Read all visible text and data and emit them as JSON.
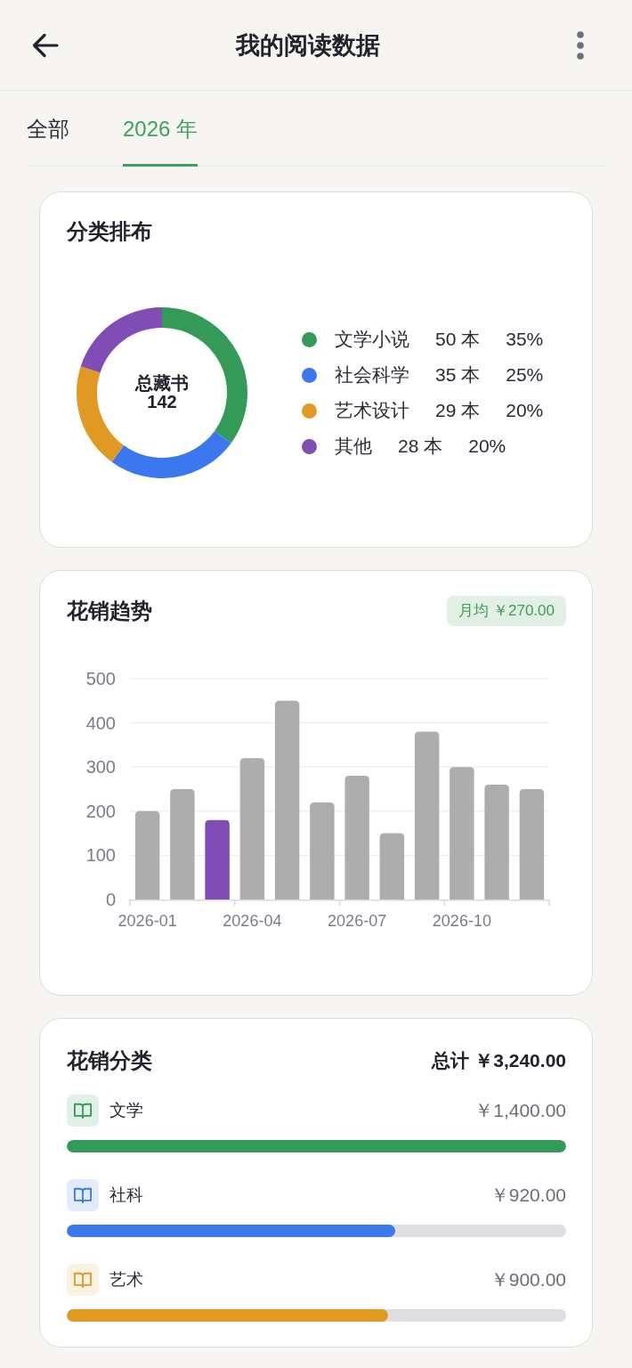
{
  "header": {
    "title": "我的阅读数据"
  },
  "tabs": [
    {
      "label": "全部",
      "selected": false
    },
    {
      "label": "2026 年",
      "selected": true
    }
  ],
  "category_card": {
    "title": "分类排布",
    "center": {
      "label": "总藏书",
      "value": "142"
    },
    "chart_data": {
      "type": "donut",
      "categories": [
        "文学小说",
        "社会科学",
        "艺术设计",
        "其他"
      ],
      "values": [
        35,
        25,
        20,
        20
      ]
    },
    "legend": [
      {
        "count": "50 本",
        "percent": "35%",
        "color": "#349a58"
      },
      {
        "count": "35 本",
        "percent": "25%",
        "color": "#3b78f0"
      },
      {
        "count": "29 本",
        "percent": "20%",
        "color": "#e09a24"
      },
      {
        "count": "28 本",
        "percent": "20%",
        "color": "#7f4db3"
      }
    ]
  },
  "trend_card": {
    "title": "花销趋势",
    "badge": "月均 ￥270.00",
    "chart_data": {
      "type": "bar",
      "categories": [
        "2026-01",
        null,
        null,
        "2026-04",
        null,
        null,
        "2026-07",
        null,
        null,
        "2026-10",
        null,
        null
      ],
      "series": [
        {
          "color": "#adadad",
          "values": [
            200,
            250,
            null,
            320,
            450,
            220,
            280,
            150,
            380,
            300,
            260,
            250
          ]
        },
        {
          "color": "#7f4db3",
          "values": [
            null,
            null,
            180,
            null,
            null,
            null,
            null,
            null,
            null,
            null,
            null,
            null
          ]
        }
      ],
      "stacked": true,
      "grid": true,
      "ylim": [
        0,
        500
      ],
      "yticks": [
        0,
        100,
        200,
        300,
        400,
        500
      ]
    }
  },
  "spend_card": {
    "title": "花销分类",
    "total": "总计 ￥3,240.00",
    "items": [
      {
        "label": "文学",
        "amount": "￥1,400.00",
        "level": 1,
        "color": "#349a58"
      },
      {
        "label": "社科",
        "amount": "￥920.00",
        "level": 0.657,
        "color": "#3b78f0"
      },
      {
        "label": "艺术",
        "amount": "￥900.00",
        "level": 0.643,
        "color": "#e09a24"
      }
    ]
  }
}
